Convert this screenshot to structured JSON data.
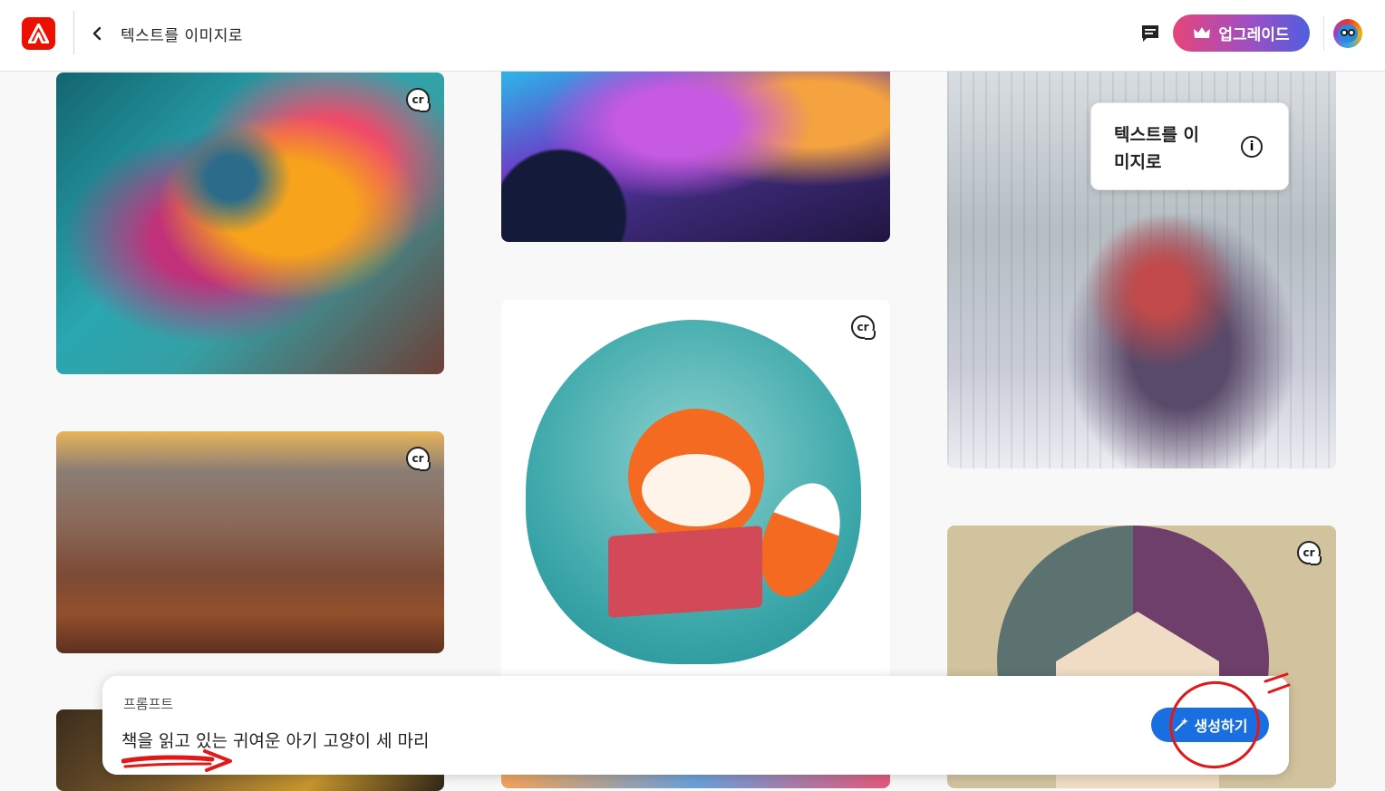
{
  "header": {
    "page_title": "텍스트를 이미지로",
    "upgrade_label": "업그레이드"
  },
  "tiles": {
    "cr_label": "cr"
  },
  "tooltip": {
    "text": "텍스트를 이미지로"
  },
  "prompt": {
    "label": "프롬프트",
    "value": "책을 읽고 있는 귀여운 아기 고양이 세 마리",
    "generate_label": "생성하기"
  },
  "colors": {
    "brand": "#eb1000",
    "generate_button": "#1a6fe0",
    "annotation": "#e0181a"
  }
}
